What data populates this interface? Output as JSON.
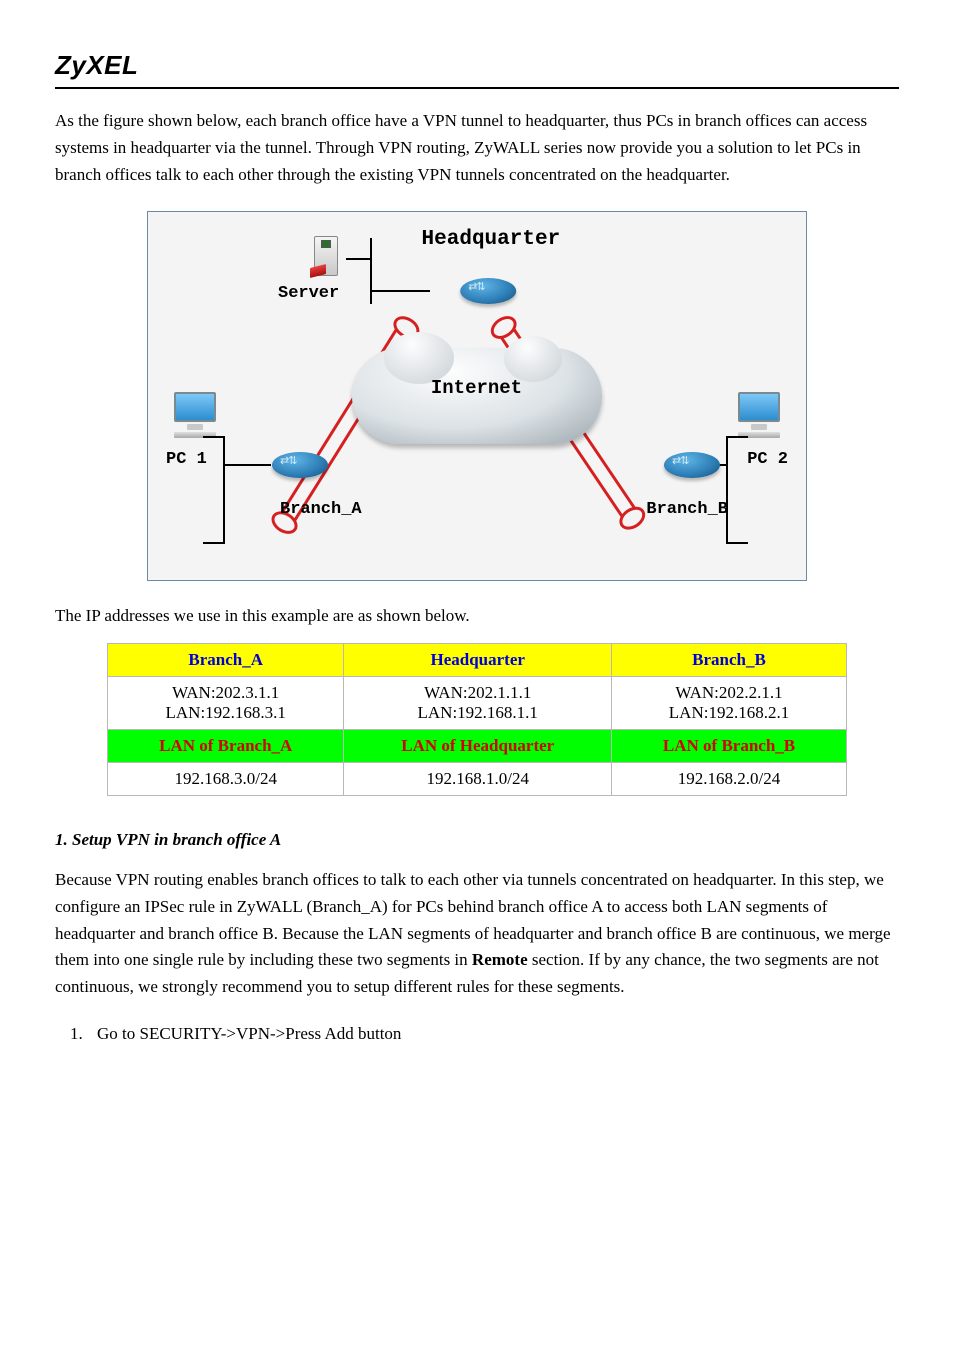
{
  "brand": "ZyXEL",
  "intro_para": "As the figure shown below, each branch office have a VPN tunnel to headquarter, thus PCs in branch offices can access systems in headquarter via the tunnel. Through VPN routing, ZyWALL series now provide you a solution to let PCs in branch offices talk to each other through the existing VPN tunnels concentrated on the headquarter.",
  "diagram": {
    "hq": "Headquarter",
    "server": "Server",
    "internet": "Internet",
    "pc1": "PC 1",
    "pc2": "PC 2",
    "branch_a": "Branch_A",
    "branch_b": "Branch_B"
  },
  "mid_para": "The IP addresses we use in this example are as shown below.",
  "table": {
    "h1": "Branch_A",
    "h2": "Headquarter",
    "h3": "Branch_B",
    "r1c1a": "WAN:202.3.1.1",
    "r1c1b": "LAN:192.168.3.1",
    "r1c2a": "WAN:202.1.1.1",
    "r1c2b": "LAN:192.168.1.1",
    "r1c3a": "WAN:202.2.1.1",
    "r1c3b": "LAN:192.168.2.1",
    "h4": "LAN of Branch_A",
    "h5": "LAN of Headquarter",
    "h6": "LAN of Branch_B",
    "r2c1": "192.168.3.0/24",
    "r2c2": "192.168.1.0/24",
    "r2c3": "192.168.2.0/24"
  },
  "step_title": "1. Setup VPN in branch office A",
  "explain_para_a": "Because VPN routing enables branch offices to talk to each other via tunnels concentrated on headquarter. In this step, we configure an IPSec rule in ZyWALL (Branch_A) for PCs behind branch office A to access both LAN segments of headquarter and branch office B. Because the LAN segments of headquarter and branch office B are continuous, we merge them into one single rule by including these two segments in ",
  "explain_bold": "Remote",
  "explain_para_b": " section. If by any chance, the two segments are not continuous, we strongly recommend you to setup different rules for these segments.",
  "step1": "Go to SECURITY->VPN->Press Add button"
}
